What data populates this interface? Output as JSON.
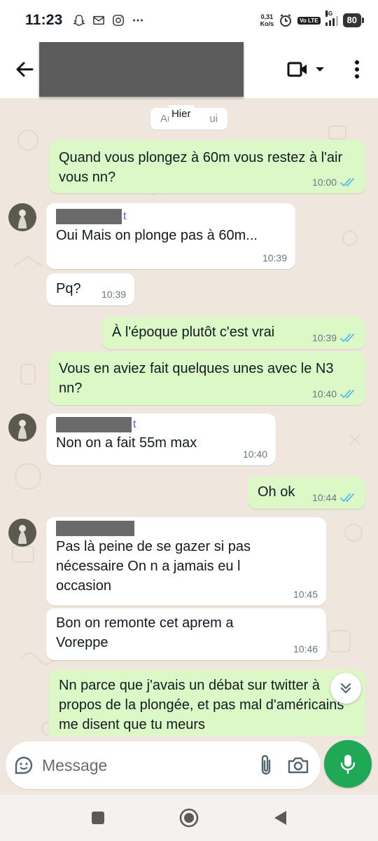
{
  "status_bar": {
    "time": "11:23",
    "net_speed_value": "0,31",
    "net_speed_unit": "Ko/s",
    "volte": "Vo LTE",
    "network": "5G",
    "battery": "80",
    "left_icons": [
      "snapchat-icon",
      "mail-icon",
      "instagram-icon",
      "more-dots-icon"
    ],
    "right_icons": [
      "alarm-icon",
      "volte-icon",
      "signal-icon",
      "battery-icon"
    ]
  },
  "header": {
    "contact_name": "",
    "icons": [
      "back-arrow-icon",
      "video-call-icon",
      "dropdown-icon",
      "overflow-menu-icon"
    ]
  },
  "chat": {
    "date_chip": {
      "hidden": "Aujourd'hui",
      "visible_prefix": "Au",
      "visible_suffix": "ui",
      "overlay": "Hier"
    },
    "messages": [
      {
        "dir": "out",
        "text": "Quand vous plongez à 60m vous restez à l'air vous nn?",
        "time": "10:00",
        "read": true
      },
      {
        "dir": "in",
        "sender_suffix": "t",
        "text": "Oui Mais on plonge pas à 60m...",
        "time": "10:39"
      },
      {
        "dir": "in",
        "text": "Pq?",
        "time": "10:39"
      },
      {
        "dir": "out",
        "text": "À l'époque plutôt c'est vrai",
        "time": "10:39",
        "read": true
      },
      {
        "dir": "out",
        "text": "Vous en aviez fait quelques unes avec le N3 nn?",
        "time": "10:40",
        "read": true
      },
      {
        "dir": "in",
        "sender_suffix": "t",
        "text": "Non  on a fait 55m max",
        "time": "10:40"
      },
      {
        "dir": "out",
        "text": "Oh ok",
        "time": "10:44",
        "read": true
      },
      {
        "dir": "in",
        "text": "Pas là peine de se gazer si pas nécessaire On n a jamais eu l occasion",
        "time": "10:45"
      },
      {
        "dir": "in",
        "text": "Bon on remonte cet aprem a Voreppe",
        "time": "10:46"
      },
      {
        "dir": "out",
        "text": "Nn parce que j'avais un débat sur twitter à propos de la plongée, et pas mal d'américains me disent que tu meurs",
        "time": ""
      }
    ]
  },
  "composer": {
    "placeholder": "Message",
    "icons": [
      "sticker-icon",
      "attach-icon",
      "camera-icon",
      "mic-icon"
    ]
  },
  "colors": {
    "outgoing_bubble": "#dcf8c6",
    "incoming_bubble": "#ffffff",
    "chat_background": "#efe7dd",
    "read_ticks": "#53bdeb",
    "mic_button": "#1fa855",
    "sender_name": "#6b4fd8"
  },
  "navbar": {
    "icons": [
      "recents-square-icon",
      "home-circle-icon",
      "back-triangle-icon"
    ]
  }
}
